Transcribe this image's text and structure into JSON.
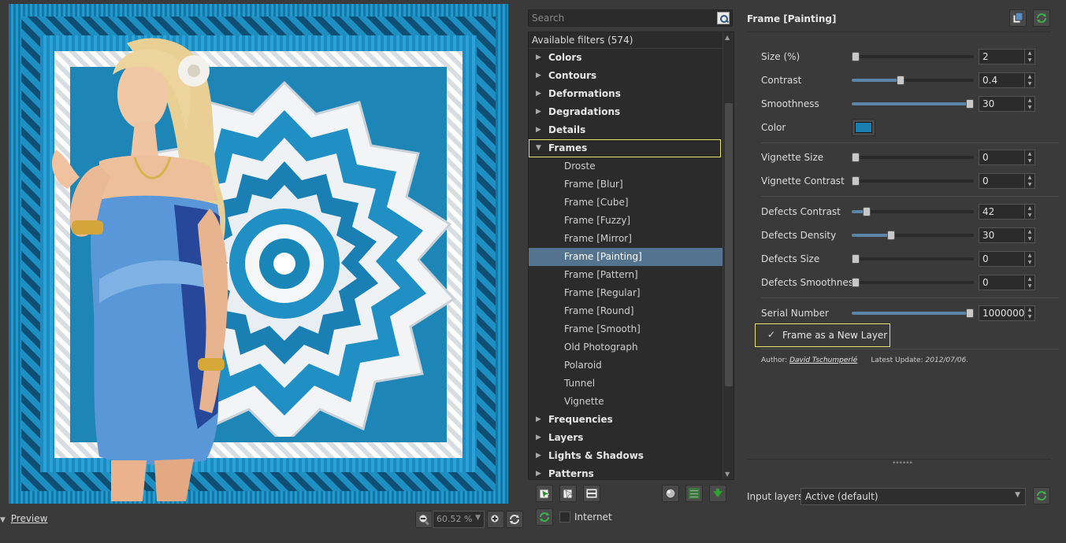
{
  "preview": {
    "toggle_label": "Preview",
    "zoom_value": "60.52 %"
  },
  "filters": {
    "search_placeholder": "Search",
    "available": "Available filters (574)",
    "categories_top": [
      {
        "label": "Colors"
      },
      {
        "label": "Contours"
      },
      {
        "label": "Deformations"
      },
      {
        "label": "Degradations"
      },
      {
        "label": "Details"
      }
    ],
    "frames_label": "Frames",
    "frames_children": [
      {
        "label": "Droste"
      },
      {
        "label": "Frame [Blur]"
      },
      {
        "label": "Frame [Cube]"
      },
      {
        "label": "Frame [Fuzzy]"
      },
      {
        "label": "Frame [Mirror]"
      },
      {
        "label": "Frame [Painting]"
      },
      {
        "label": "Frame [Pattern]"
      },
      {
        "label": "Frame [Regular]"
      },
      {
        "label": "Frame [Round]"
      },
      {
        "label": "Frame [Smooth]"
      },
      {
        "label": "Old Photograph"
      },
      {
        "label": "Polaroid"
      },
      {
        "label": "Tunnel"
      },
      {
        "label": "Vignette"
      }
    ],
    "categories_bottom": [
      {
        "label": "Frequencies"
      },
      {
        "label": "Layers"
      },
      {
        "label": "Lights & Shadows"
      },
      {
        "label": "Patterns"
      }
    ],
    "internet_label": "Internet"
  },
  "params": {
    "title": "Frame [Painting]",
    "rows": {
      "size": {
        "label": "Size (%)",
        "value": "2",
        "level": 0.02
      },
      "contrast": {
        "label": "Contrast",
        "value": "0.4",
        "level": 0.4
      },
      "smoothness": {
        "label": "Smoothness",
        "value": "30",
        "level": 1.0
      },
      "color": {
        "label": "Color",
        "swatch": "#1a7fb0"
      },
      "vignette_size": {
        "label": "Vignette Size",
        "value": "0",
        "level": 0
      },
      "vignette_contrast": {
        "label": "Vignette Contrast",
        "value": "0",
        "level": 0
      },
      "defects_contrast": {
        "label": "Defects Contrast",
        "value": "42",
        "level": 0.12
      },
      "defects_density": {
        "label": "Defects Density",
        "value": "30",
        "level": 0.32
      },
      "defects_size": {
        "label": "Defects Size",
        "value": "0",
        "level": 0
      },
      "defects_smoothness": {
        "label": "Defects Smoothness",
        "value": "0",
        "level": 0
      },
      "serial_number": {
        "label": "Serial Number",
        "value": "1000000",
        "level": 1.0
      }
    },
    "new_layer_label": "Frame as a New Layer",
    "author_prefix": "Author:",
    "author_name": "David Tschumperlé",
    "update_prefix": "Latest Update:",
    "update_date": "2012/07/06."
  },
  "input_layers": {
    "label": "Input layers",
    "value": "Active (default)"
  },
  "colors": {
    "accent_selection": "#53738f",
    "highlight_outline": "#e8e36a",
    "preview_blue": "#1a86b8"
  }
}
